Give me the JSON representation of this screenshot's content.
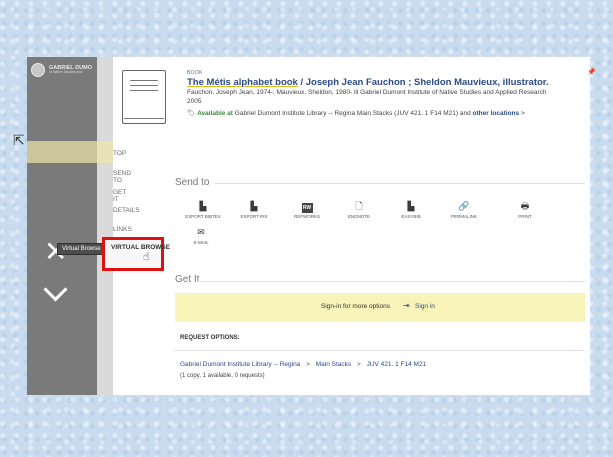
{
  "sidebar": {
    "brand_title": "GABRIEL DUMO",
    "brand_subtitle": "of Native Studies and",
    "nav": [
      {
        "label": "TOP"
      },
      {
        "label": "SEND TO"
      },
      {
        "label": "GET IT"
      },
      {
        "label": "DETAILS"
      },
      {
        "label": "LINKS"
      },
      {
        "label": "VIRTUAL BROWSE"
      }
    ]
  },
  "tooltip": "Virtual Browse",
  "record": {
    "type": "BOOK",
    "title_highlight": "The Métis alphabet book",
    "title_rest": " / Joseph Jean Fauchon ; Sheldon Mauvieux, illustrator.",
    "authors": "Fauchon, Joseph Jean, 1974-; Mauvieux, Sheldon, 1980- ill Gabriel Dumont Institute of Native Studies and Applied Research",
    "year": "2005",
    "availability_status": "Available at",
    "availability_location": "Gabriel Dumont Institute Library -- Regina  Main Stacks (JUV 421. 1 F14 M21)",
    "availability_and": "and",
    "availability_link": "other locations",
    "availability_chevron": ">"
  },
  "send_to": {
    "heading": "Send to",
    "tools": [
      {
        "icon": "export-bibtex-icon",
        "label": "EXPORT BIBTEX"
      },
      {
        "icon": "export-ris-icon",
        "label": "EXPORT RIS"
      },
      {
        "icon": "refworks-icon",
        "label": "REFWORKS",
        "badge": "RW"
      },
      {
        "icon": "endnote-icon",
        "label": "ENDNOTE"
      },
      {
        "icon": "easybib-icon",
        "label": "EASYBIB"
      },
      {
        "icon": "permalink-icon",
        "label": "PERMALINK"
      },
      {
        "icon": "print-icon",
        "label": "PRINT"
      },
      {
        "icon": "email-icon",
        "label": "E-MAIL"
      }
    ]
  },
  "get_it": {
    "heading": "Get It",
    "signin_prompt": "Sign-in for more options",
    "signin_link": "Sign in",
    "request_options": "REQUEST OPTIONS:",
    "location": {
      "library": "Gabriel Dumont Institute Library -- Regina",
      "collection": "Main Stacks",
      "call_number": "JUV 421. 1 F14 M21",
      "separator": ">"
    },
    "copies": "(1 copy, 1 available, 0 requests)"
  },
  "colors": {
    "link": "#2c4b86",
    "highlight_box": "#e01010",
    "signin_bg": "#f8f3b8",
    "available": "#3b8a3b"
  }
}
